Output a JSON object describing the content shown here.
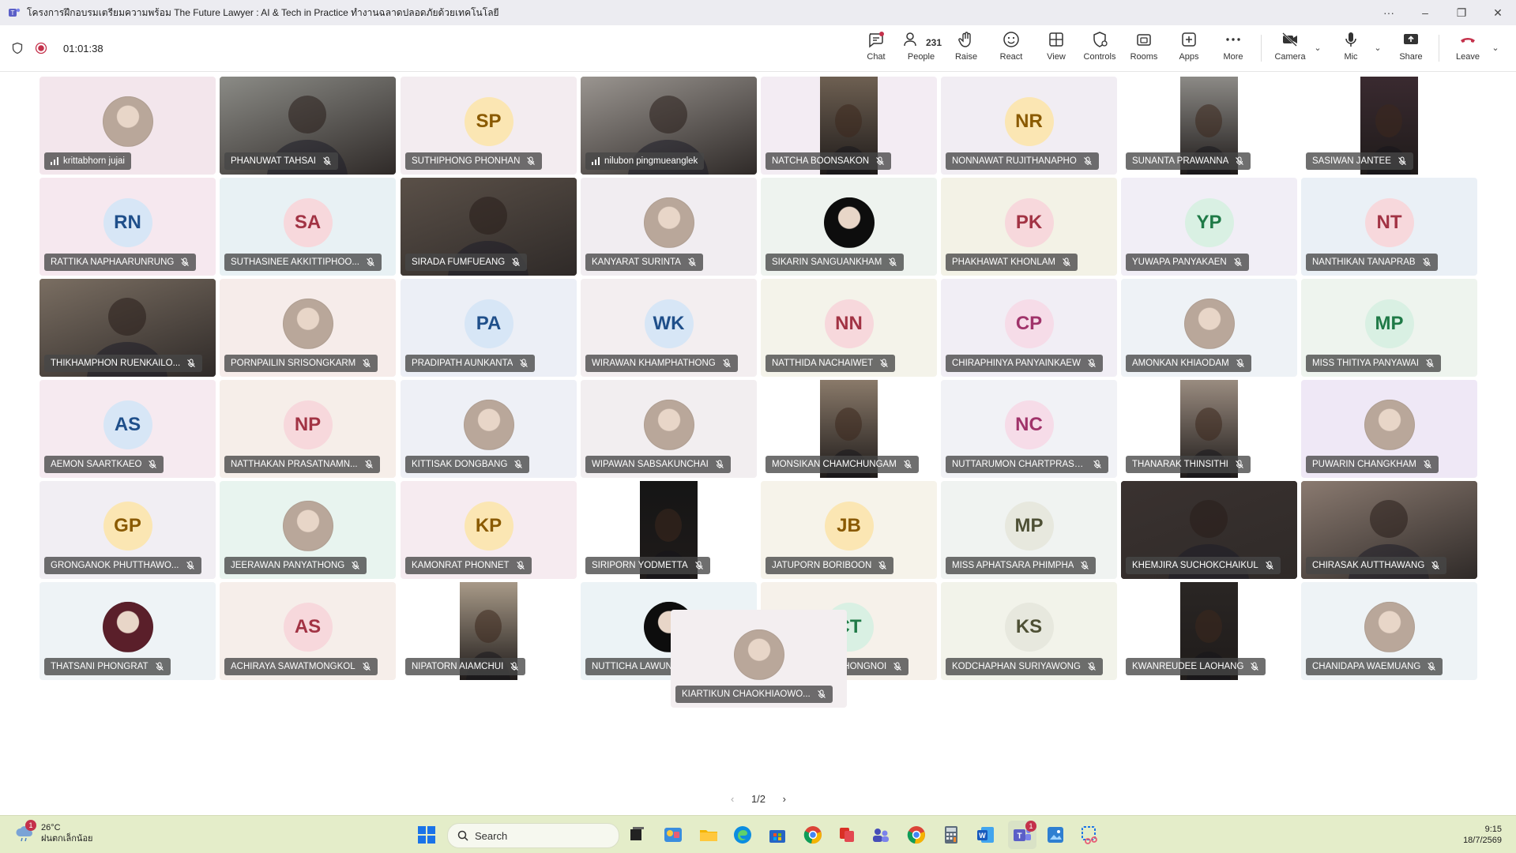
{
  "window": {
    "title": "โครงการฝึกอบรมเตรียมความพร้อม The Future Lawyer : AI & Tech in Practice ทำงานฉลาดปลอดภัยด้วยเทคโนโลยี",
    "more": "···",
    "minimize": "–",
    "restore": "❐",
    "close": "✕"
  },
  "toolbar": {
    "timer": "01:01:38",
    "people_count": "231",
    "labels": {
      "chat": "Chat",
      "people": "People",
      "raise": "Raise",
      "react": "React",
      "view": "View",
      "controls": "Controls",
      "rooms": "Rooms",
      "apps": "Apps",
      "more": "More",
      "camera": "Camera",
      "mic": "Mic",
      "share": "Share",
      "leave": "Leave"
    }
  },
  "participants": [
    {
      "name": "krittabhorn jujai",
      "type": "photo",
      "color": "#f3e6ec",
      "speaking": true
    },
    {
      "name": "PHANUWAT TAHSAI",
      "type": "video",
      "color": "#8b8b86"
    },
    {
      "name": "SUTHIPHONG PHONHAN",
      "initials": "SP",
      "type": "initials",
      "color": "#f3ecf0",
      "avatar": "#fbe6b3",
      "ink": "#8a5a00"
    },
    {
      "name": "nilubon pingmueanglek",
      "type": "video",
      "color": "#9a9590",
      "speaking": true
    },
    {
      "name": "NATCHA BOONSAKON",
      "type": "narrow",
      "color": "#f3ecf3",
      "video": "#6e6052"
    },
    {
      "name": "NONNAWAT RUJITHANAPHO",
      "initials": "NR",
      "type": "initials",
      "color": "#f1edf3",
      "avatar": "#fbe6b3",
      "ink": "#8a5a00"
    },
    {
      "name": "SUNANTA PRAWANNA",
      "type": "narrow",
      "color": "#ffffff",
      "video": "#8c8a86"
    },
    {
      "name": "SASIWAN JANTEE",
      "type": "narrow",
      "color": "#ffffff",
      "video": "#3a2a30"
    },
    {
      "name": "RATTIKA NAPHAARUNRUNG",
      "initials": "RN",
      "type": "initials",
      "color": "#f6e8ef",
      "avatar": "#d7e6f6",
      "ink": "#1f4f8a"
    },
    {
      "name": "SUTHASINEE AKKITTIPHOO...",
      "initials": "SA",
      "type": "initials",
      "color": "#e8f1f4",
      "avatar": "#f7d8dc",
      "ink": "#a23344"
    },
    {
      "name": "SIRADA FUMFUEANG",
      "type": "video",
      "color": "#5a5048"
    },
    {
      "name": "KANYARAT SURINTA",
      "type": "photo",
      "color": "#f1edf1"
    },
    {
      "name": "SIKARIN SANGUANKHAM",
      "type": "photo-dark",
      "color": "#eef3ef"
    },
    {
      "name": "PHAKHAWAT KHONLAM",
      "initials": "PK",
      "type": "initials",
      "color": "#f3f2e6",
      "avatar": "#f7d8dc",
      "ink": "#a23344"
    },
    {
      "name": "YUWAPA PANYAKAEN",
      "initials": "YP",
      "type": "initials",
      "color": "#f1eef6",
      "avatar": "#d9f0e3",
      "ink": "#1f7a47"
    },
    {
      "name": "NANTHIKAN TANAPRAB",
      "initials": "NT",
      "type": "initials",
      "color": "#eaf0f6",
      "avatar": "#f7d8dc",
      "ink": "#a23344"
    },
    {
      "name": "THIKHAMPHON RUENKAILO...",
      "type": "video",
      "color": "#7a6e62"
    },
    {
      "name": "PORNPAILIN SRISONGKARM",
      "type": "photo",
      "color": "#f6ecea"
    },
    {
      "name": "PRADIPATH AUNKANTA",
      "initials": "PA",
      "type": "initials",
      "color": "#eceff6",
      "avatar": "#d7e6f6",
      "ink": "#1f4f8a"
    },
    {
      "name": "WIRAWAN KHAMPHATHONG",
      "initials": "WK",
      "type": "initials",
      "color": "#f3eef0",
      "avatar": "#d7e6f6",
      "ink": "#1f4f8a"
    },
    {
      "name": "NATTHIDA NACHAIWET",
      "initials": "NN",
      "type": "initials",
      "color": "#f4f3ea",
      "avatar": "#f7d8dc",
      "ink": "#a23344"
    },
    {
      "name": "CHIRAPHINYA PANYAINKAEW",
      "initials": "CP",
      "type": "initials",
      "color": "#f1eef5",
      "avatar": "#f6dce8",
      "ink": "#a0336a"
    },
    {
      "name": "AMONKAN KHIAODAM",
      "type": "photo",
      "color": "#eef2f6"
    },
    {
      "name": "MISS THITIYA PANYAWAI",
      "initials": "MP",
      "type": "initials",
      "color": "#eef4ee",
      "avatar": "#d9f0e3",
      "ink": "#1f7a47"
    },
    {
      "name": "AEMON SAARTKAEO",
      "initials": "AS",
      "type": "initials",
      "color": "#f6eaf0",
      "avatar": "#d7e6f6",
      "ink": "#1f4f8a"
    },
    {
      "name": "NATTHAKAN PRASATNAMN...",
      "initials": "NP",
      "type": "initials",
      "color": "#f6eee9",
      "avatar": "#f7d8dc",
      "ink": "#a23344"
    },
    {
      "name": "KITTISAK DONGBANG",
      "type": "photo",
      "color": "#eef0f6"
    },
    {
      "name": "WIPAWAN SABSAKUNCHAI",
      "type": "photo",
      "color": "#f2eef0"
    },
    {
      "name": "MONSIKAN CHAMCHUNGAM",
      "type": "narrow",
      "color": "#ffffff",
      "video": "#8a7a6a"
    },
    {
      "name": "NUTTARUMON CHARTPRASE...",
      "initials": "NC",
      "type": "initials",
      "color": "#f1f2f6",
      "avatar": "#f6dce8",
      "ink": "#a0336a"
    },
    {
      "name": "THANARAK THINSITHI",
      "type": "narrow",
      "color": "#ffffff",
      "video": "#9a8c80"
    },
    {
      "name": "PUWARIN CHANGKHAM",
      "type": "photo",
      "color": "#efe8f6"
    },
    {
      "name": "GRONGANOK PHUTTHAWO...",
      "initials": "GP",
      "type": "initials",
      "color": "#f1eef3",
      "avatar": "#fbe6b3",
      "ink": "#8a5a00"
    },
    {
      "name": "JEERAWAN PANYATHONG",
      "type": "photo",
      "color": "#e8f4ef"
    },
    {
      "name": "KAMONRAT PHONNET",
      "initials": "KP",
      "type": "initials",
      "color": "#f6ebf0",
      "avatar": "#fbe6b3",
      "ink": "#8a5a00"
    },
    {
      "name": "SIRIPORN YODMETTA",
      "type": "narrow",
      "color": "#ffffff",
      "video": "#151515"
    },
    {
      "name": "JATUPORN BORIBOON",
      "initials": "JB",
      "type": "initials",
      "color": "#f6f3ea",
      "avatar": "#fbe6b3",
      "ink": "#8a5a00"
    },
    {
      "name": "MISS APHATSARA PHIMPHA",
      "initials": "MP",
      "type": "initials",
      "color": "#f0f3f1",
      "avatar": "#e7e8de",
      "ink": "#4e5035"
    },
    {
      "name": "KHEMJIRA SUCHOKCHAIKUL",
      "type": "video",
      "color": "#3a3230"
    },
    {
      "name": "CHIRASAK AUTTHAWANG",
      "type": "video",
      "color": "#8a7a70"
    },
    {
      "name": "THATSANI PHONGRAT",
      "type": "photo-dark2",
      "color": "#eef3f6"
    },
    {
      "name": "ACHIRAYA SAWATMONGKOL",
      "initials": "AS",
      "type": "initials",
      "color": "#f6eeea",
      "avatar": "#f7d8dc",
      "ink": "#a23344"
    },
    {
      "name": "NIPATORN AIAMCHUI",
      "type": "narrow",
      "color": "#ffffff",
      "video": "#a89a88"
    },
    {
      "name": "NUTTICHA LAWUNDEE",
      "type": "photo-dark",
      "color": "#ecf3f6"
    },
    {
      "name": "CHONRATHAN THONGNOI",
      "initials": "CT",
      "type": "initials",
      "color": "#f6f1ea",
      "avatar": "#d9f0e3",
      "ink": "#1f7a47"
    },
    {
      "name": "KODCHAPHAN SURIYAWONG",
      "initials": "KS",
      "type": "initials",
      "color": "#f2f3ea",
      "avatar": "#e7e8de",
      "ink": "#4e5035"
    },
    {
      "name": "KWANREUDEE LAOHANG",
      "type": "narrow",
      "color": "#ffffff",
      "video": "#2a2624"
    },
    {
      "name": "CHANIDAPA WAEMUANG",
      "type": "photo",
      "color": "#eef3f6"
    },
    {
      "name": "KIARTIKUN CHAOKHIAOWO...",
      "type": "photo",
      "color": "#f3eef0"
    }
  ],
  "pager": {
    "prev": "‹",
    "label": "1/2",
    "next": "›"
  },
  "taskbar": {
    "weather_temp": "26°C",
    "weather_desc": "ฝนตกเล็กน้อย",
    "weather_badge": "1",
    "search_label": "Search",
    "teams_badge": "1",
    "time": "9:15",
    "date": "18/7/2569"
  }
}
